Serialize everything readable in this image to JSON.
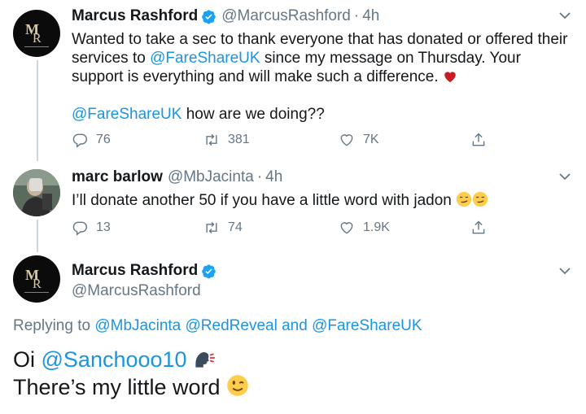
{
  "tweet1": {
    "name": "Marcus Rashford",
    "handle": "@MarcusRashford",
    "dot": "·",
    "time": "4h",
    "text_before": "Wanted to take a sec to thank everyone that has donated or offered their services to ",
    "mention1": "@FareShareUK",
    "text_after": " since my message on Thursday. Your support is everything and will make such a difference.",
    "mention2": "@FareShareUK",
    "text_line2": " how are we doing??",
    "replies": "76",
    "retweets": "381",
    "likes": "7K"
  },
  "tweet2": {
    "name": "marc barlow",
    "handle": "@MbJacinta",
    "dot": "·",
    "time": "4h",
    "text": "I’ll donate another 50 if you have a little word with jadon",
    "replies": "13",
    "retweets": "74",
    "likes": "1.9K"
  },
  "tweet3": {
    "name": "Marcus Rashford",
    "handle": "@MarcusRashford",
    "replying_prefix": "Replying to ",
    "replying_mention1": "@MbJacinta",
    "replying_mention2": "@RedReveal",
    "replying_and": " and ",
    "replying_mention3": "@FareShareUK",
    "line1_prefix": "Oi ",
    "line1_mention": "@Sanchooo10",
    "line2": "There’s my little word"
  },
  "colors": {
    "link": "#1b95e0",
    "muted": "#657786",
    "verified": "#1da1f2",
    "heart": "#e0245e",
    "thread": "#ccd6dd"
  },
  "icons": [
    "verified-badge-icon",
    "chevron-down-icon",
    "reply-icon",
    "retweet-icon",
    "like-icon",
    "share-icon",
    "heart-emoji",
    "smirk-emoji",
    "speaking-head-emoji",
    "wink-emoji"
  ]
}
